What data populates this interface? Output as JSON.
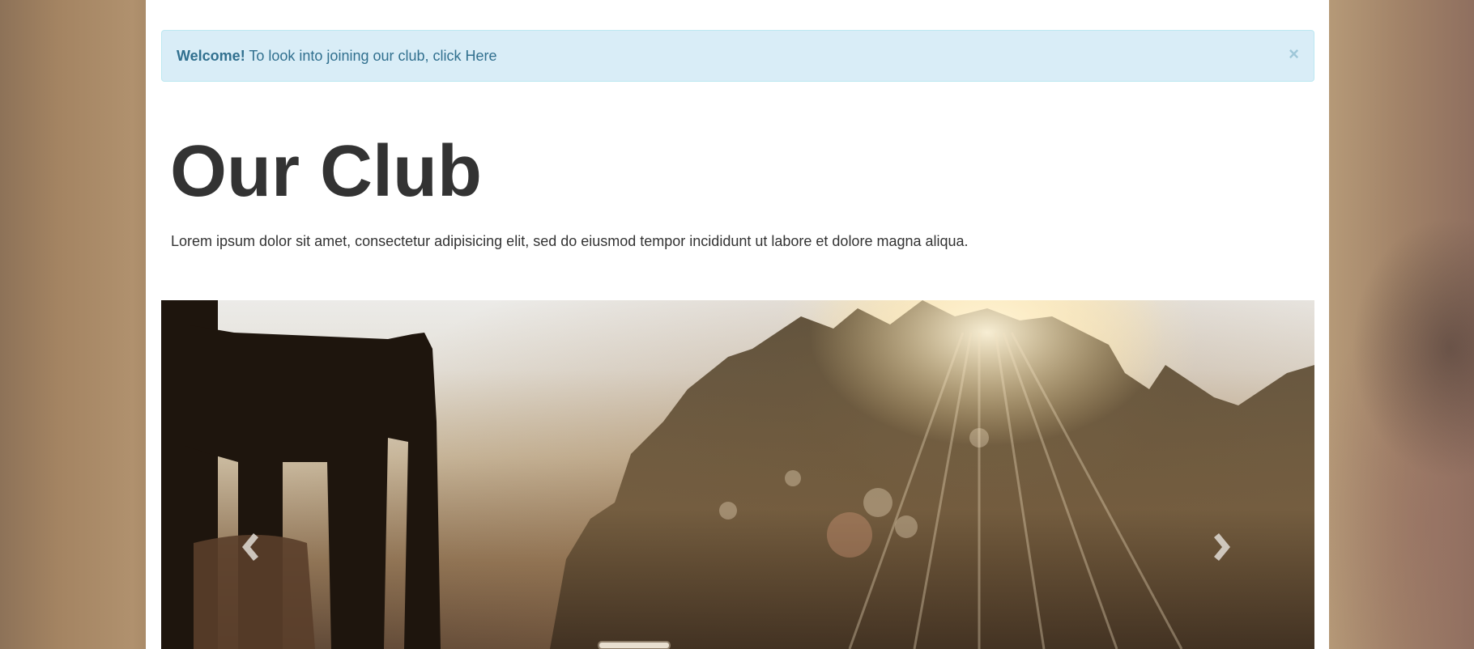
{
  "alert": {
    "strong": "Welcome!",
    "text": " To look into joining our club, click ",
    "link": "Here",
    "close": "×"
  },
  "jumbotron": {
    "title": "Our Club",
    "text": "Lorem ipsum dolor sit amet, consectetur adipisicing elit, sed do eiusmod tempor incididunt ut labore et dolore magna aliqua."
  },
  "carousel": {
    "prev_icon": "chevron-left-icon",
    "next_icon": "chevron-right-icon"
  },
  "colors": {
    "alert_bg": "#d9edf7",
    "alert_text": "#31708f",
    "heading": "#333333"
  }
}
